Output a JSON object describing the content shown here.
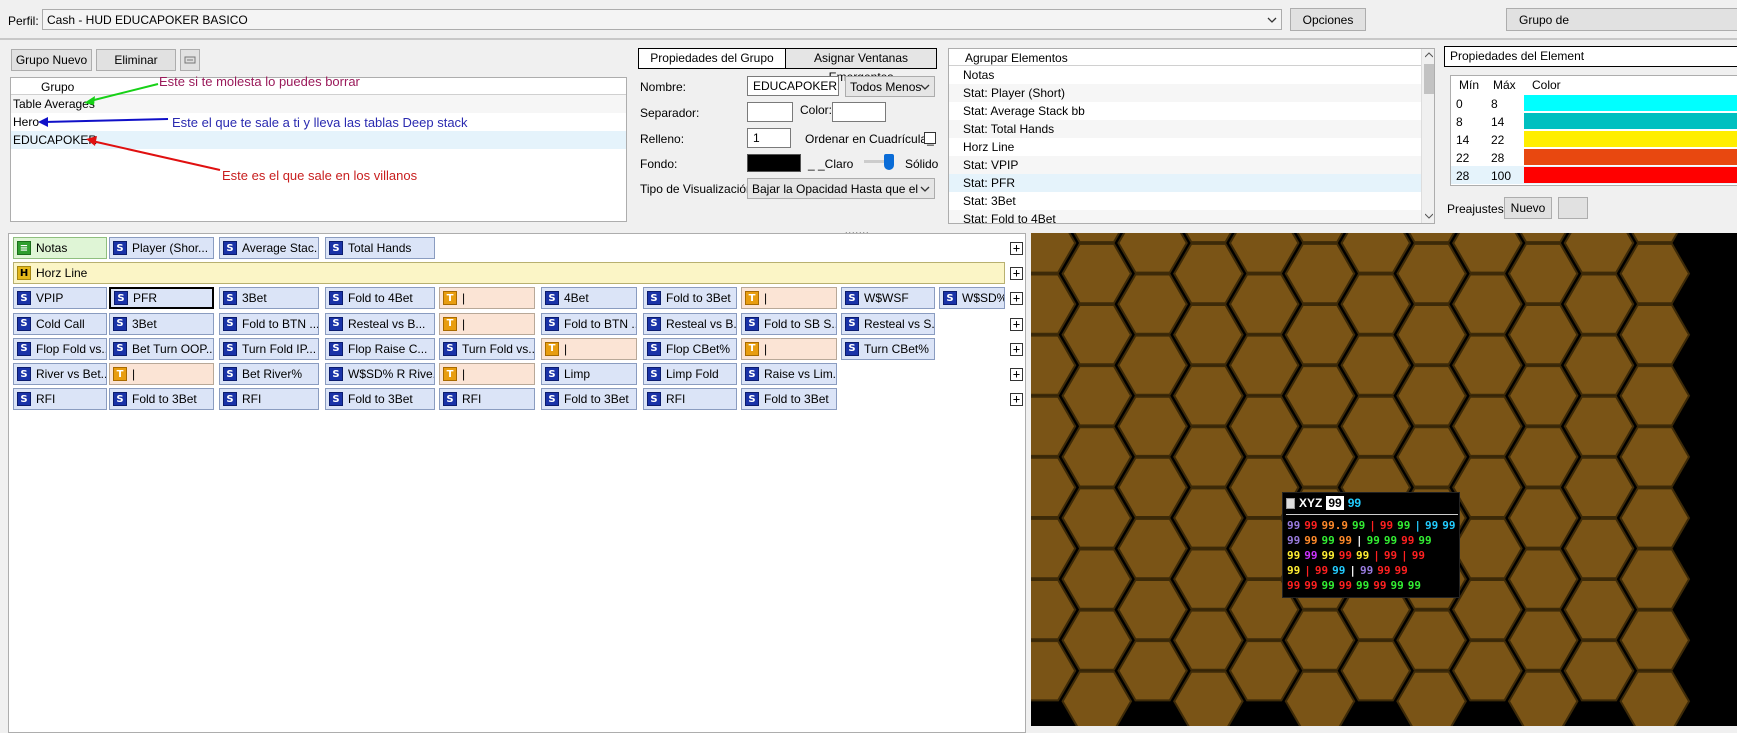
{
  "top": {
    "perfil_label": "Perfil:",
    "perfil_value": "Cash - HUD EDUCAPOKER BASICO",
    "opciones": "Opciones",
    "grupo_de": "Grupo de"
  },
  "left_toolbar": {
    "nuevo": "Grupo Nuevo",
    "eliminar": "Eliminar"
  },
  "group_list": {
    "header": "Grupo",
    "items": [
      "Table Averages",
      "Hero",
      "EDUCAPOKER"
    ]
  },
  "annotations": {
    "green": "Este si te molesta lo puedes borrar",
    "blue": "Este el que te sale a ti y lleva las tablas Deep stack",
    "red": "Este es el que sale en los villanos",
    "green_color": "#17d117",
    "blue_color": "#1010c8",
    "red_color": "#e01010"
  },
  "props": {
    "tab1": "Propiedades del Grupo",
    "tab2": "Asignar Ventanas Emergentes",
    "nombre_label": "Nombre:",
    "nombre_value": "EDUCAPOKER",
    "nombre_combo": "Todos Menos H",
    "separador_label": "Separador:",
    "color_label": "Color:",
    "relleno_label": "Relleno:",
    "relleno_value": "1",
    "ordenar_label": "Ordenar en Cuadrícula_",
    "fondo_label": "Fondo:",
    "claro_label": "_ _Claro",
    "solido_label": "Sólido",
    "tipo_label": "Tipo de Visualización:",
    "tipo_value": "Bajar la Opacidad Hasta que el Mou"
  },
  "agrupar": {
    "header": "Agrupar Elementos",
    "items": [
      "Notas",
      "Stat: Player (Short)",
      "Stat: Average Stack bb",
      "Stat: Total Hands",
      "Horz Line",
      "Stat: VPIP",
      "Stat: PFR",
      "Stat: 3Bet",
      "Stat: Fold to 4Bet"
    ],
    "selected_index": 6
  },
  "right_panel": {
    "header": "Propiedades del Element",
    "cols": [
      "Mín",
      "Máx",
      "Color"
    ],
    "rows": [
      {
        "min": "0",
        "max": "8",
        "color": "#00ffff"
      },
      {
        "min": "8",
        "max": "14",
        "color": "#00c0c0"
      },
      {
        "min": "14",
        "max": "22",
        "color": "#ffee00"
      },
      {
        "min": "22",
        "max": "28",
        "color": "#e84810"
      },
      {
        "min": "28",
        "max": "100",
        "color": "#ff0000"
      }
    ],
    "preajustes": "Preajustes:",
    "nuevo": "Nuevo"
  },
  "hud_rows": [
    [
      {
        "t": "n",
        "label": "Notas"
      },
      {
        "t": "s",
        "label": "Player (Shor..."
      },
      {
        "t": "s",
        "label": "Average Stac..."
      },
      {
        "t": "s",
        "label": "Total Hands"
      }
    ],
    [
      {
        "t": "h",
        "label": "Horz Line"
      }
    ],
    [
      {
        "t": "s",
        "label": "VPIP"
      },
      {
        "t": "s",
        "label": "PFR",
        "sel": true
      },
      {
        "t": "s",
        "label": "3Bet"
      },
      {
        "t": "s",
        "label": "Fold to 4Bet"
      },
      {
        "t": "t",
        "label": "|"
      },
      {
        "t": "s",
        "label": "4Bet"
      },
      {
        "t": "s",
        "label": "Fold to 3Bet"
      },
      {
        "t": "t",
        "label": "|"
      },
      {
        "t": "s",
        "label": "W$WSF"
      },
      {
        "t": "s",
        "label": "W$SD%"
      }
    ],
    [
      {
        "t": "s",
        "label": "Cold Call"
      },
      {
        "t": "s",
        "label": "3Bet"
      },
      {
        "t": "s",
        "label": "Fold to BTN ..."
      },
      {
        "t": "s",
        "label": "Resteal vs B..."
      },
      {
        "t": "t",
        "label": "|"
      },
      {
        "t": "s",
        "label": "Fold to BTN ..."
      },
      {
        "t": "s",
        "label": "Resteal vs B..."
      },
      {
        "t": "s",
        "label": "Fold to SB S..."
      },
      {
        "t": "s",
        "label": "Resteal vs S..."
      }
    ],
    [
      {
        "t": "s",
        "label": "Flop Fold vs..."
      },
      {
        "t": "s",
        "label": "Bet Turn OOP..."
      },
      {
        "t": "s",
        "label": "Turn Fold IP..."
      },
      {
        "t": "s",
        "label": "Flop Raise C..."
      },
      {
        "t": "s",
        "label": "Turn Fold vs..."
      },
      {
        "t": "t",
        "label": "|"
      },
      {
        "t": "s",
        "label": "Flop CBet%"
      },
      {
        "t": "t",
        "label": "|"
      },
      {
        "t": "s",
        "label": "Turn CBet%"
      }
    ],
    [
      {
        "t": "s",
        "label": "River vs Bet..."
      },
      {
        "t": "t",
        "label": "|"
      },
      {
        "t": "s",
        "label": "Bet River%"
      },
      {
        "t": "s",
        "label": "W$SD% R Rive..."
      },
      {
        "t": "t",
        "label": "|"
      },
      {
        "t": "s",
        "label": "Limp"
      },
      {
        "t": "s",
        "label": "Limp Fold"
      },
      {
        "t": "s",
        "label": "Raise vs Lim..."
      }
    ],
    [
      {
        "t": "s",
        "label": "RFI"
      },
      {
        "t": "s",
        "label": "Fold to 3Bet"
      },
      {
        "t": "s",
        "label": "RFI"
      },
      {
        "t": "s",
        "label": "Fold to 3Bet"
      },
      {
        "t": "s",
        "label": "RFI"
      },
      {
        "t": "s",
        "label": "Fold to 3Bet"
      },
      {
        "t": "s",
        "label": "RFI"
      },
      {
        "t": "s",
        "label": "Fold to 3Bet"
      }
    ]
  ],
  "preview": {
    "player": "XYZ",
    "badge": "99",
    "badge2": "99",
    "rows": [
      [
        [
          "99",
          "#9a7ce0"
        ],
        [
          "99",
          "#ff2020"
        ],
        [
          "99.9",
          "#ff8a2a"
        ],
        [
          "99",
          "#33ee33"
        ],
        [
          "|",
          "#ff2020"
        ],
        [
          "99",
          "#ff2020"
        ],
        [
          "99",
          "#33ee33"
        ],
        [
          "|",
          "#22ccff"
        ],
        [
          "99",
          "#22ccff"
        ],
        [
          "99",
          "#22ccff"
        ]
      ],
      [
        [
          "99",
          "#9a7ce0"
        ],
        [
          "99",
          "#ff8a2a"
        ],
        [
          "99",
          "#33ee33"
        ],
        [
          "99",
          "#ff8a2a"
        ],
        [
          "|",
          "#ffffff"
        ],
        [
          "99",
          "#33ee33"
        ],
        [
          "99",
          "#33ee33"
        ],
        [
          "99",
          "#ff2020"
        ],
        [
          "99",
          "#33ee33"
        ]
      ],
      [
        [
          "99",
          "#ffee33"
        ],
        [
          "99",
          "#cc33ff"
        ],
        [
          "99",
          "#ffee33"
        ],
        [
          "99",
          "#ff2020"
        ],
        [
          "99",
          "#ffee33"
        ],
        [
          "|",
          "#ff2020"
        ],
        [
          "99",
          "#ff2020"
        ],
        [
          "|",
          "#ff2020"
        ],
        [
          "99",
          "#ff2020"
        ]
      ],
      [
        [
          "99",
          "#ffee33"
        ],
        [
          "|",
          "#ff2020"
        ],
        [
          "99",
          "#ff2020"
        ],
        [
          "99",
          "#22ccff"
        ],
        [
          "|",
          "#ffffff"
        ],
        [
          "99",
          "#9a7ce0"
        ],
        [
          "99",
          "#ff2020"
        ],
        [
          "99",
          "#ff2020"
        ]
      ],
      [
        [
          "99",
          "#ff2020"
        ],
        [
          "99",
          "#ff2020"
        ],
        [
          "99",
          "#33ee33"
        ],
        [
          "99",
          "#ff2020"
        ],
        [
          "99",
          "#33ee33"
        ],
        [
          "99",
          "#ff2020"
        ],
        [
          "99",
          "#33ee33"
        ],
        [
          "99",
          "#33ee33"
        ]
      ]
    ]
  }
}
